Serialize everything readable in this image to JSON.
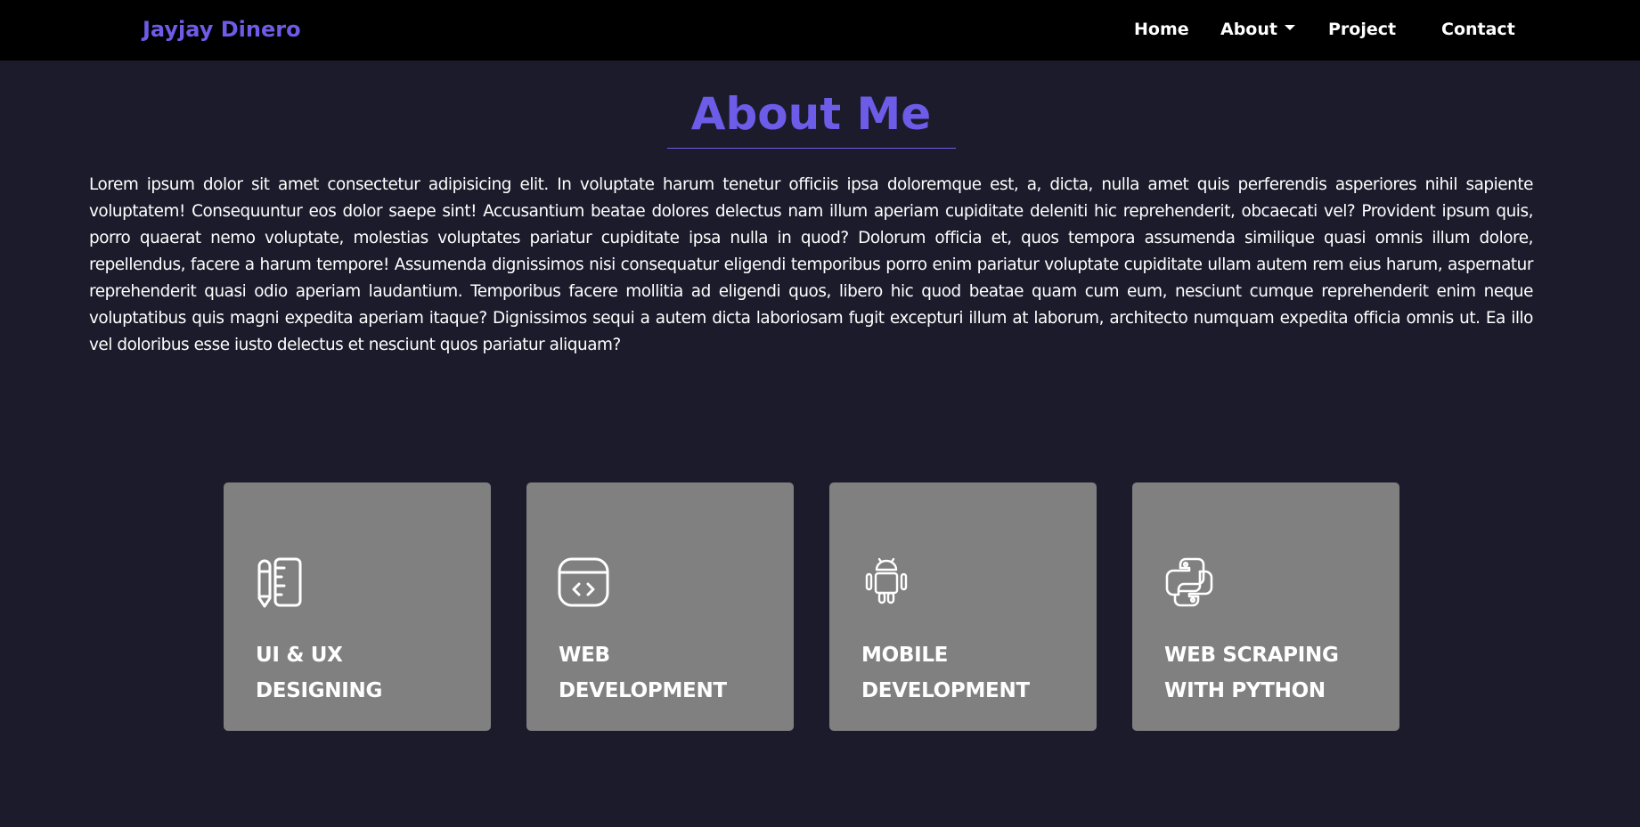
{
  "navbar": {
    "brand": "Jayjay Dinero",
    "links": [
      {
        "label": "Home"
      },
      {
        "label": "About"
      },
      {
        "label": "Project"
      },
      {
        "label": "Contact"
      }
    ]
  },
  "about": {
    "title": "About Me",
    "text": "Lorem ipsum dolor sit amet consectetur adipisicing elit. In voluptate harum tenetur officiis ipsa doloremque est, a, dicta, nulla amet quis perferendis asperiores nihil sapiente voluptatem! Consequuntur eos dolor saepe sint! Accusantium beatae dolores delectus nam illum aperiam cupiditate deleniti hic reprehenderit, obcaecati vel? Provident ipsum quis, porro quaerat nemo voluptate, molestias voluptates pariatur cupiditate ipsa nulla in quod? Dolorum officia et, quos tempora assumenda similique quasi omnis illum dolore, repellendus, facere a harum tempore! Assumenda dignissimos nisi consequatur eligendi temporibus porro enim pariatur voluptate cupiditate ullam autem rem eius harum, aspernatur reprehenderit quasi odio aperiam laudantium. Temporibus facere mollitia ad eligendi quos, libero hic quod beatae quam cum eum, nesciunt cumque reprehenderit enim neque voluptatibus quis magni expedita aperiam itaque? Dignissimos sequi a autem dicta laboriosam fugit excepturi illum at laborum, architecto numquam expedita officia omnis ut. Ea illo vel doloribus esse iusto delectus et nesciunt quos pariatur aliquam?"
  },
  "services": [
    {
      "icon": "pencil-ruler-icon",
      "line1": "UI & UX",
      "line2": "DESIGNING"
    },
    {
      "icon": "browser-code-icon",
      "line1": "WEB",
      "line2": "DEVELOPMENT"
    },
    {
      "icon": "android-robot-icon",
      "line1": "MOBILE",
      "line2": "DEVELOPMENT"
    },
    {
      "icon": "python-logo-icon",
      "line1": "WEB SCRAPING",
      "line2": "WITH PYTHON"
    }
  ],
  "colors": {
    "background": "#1c1b2b",
    "navbar": "#000000",
    "accent": "#6c5ce7",
    "card": "#808080",
    "text": "#ffffff"
  }
}
